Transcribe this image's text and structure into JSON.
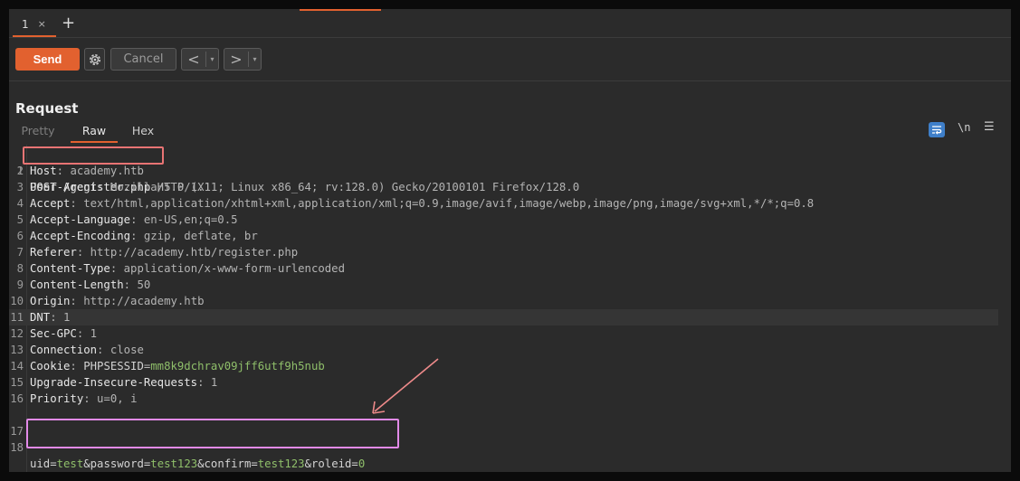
{
  "tabs": {
    "active": "1",
    "close": "×",
    "new": "+"
  },
  "toolbar": {
    "send": "Send",
    "cancel": "Cancel",
    "back": "<",
    "forward": ">",
    "dropdown": "▾"
  },
  "panel": {
    "title": "Request",
    "view_tabs": [
      "Pretty",
      "Raw",
      "Hex"
    ],
    "active_view": "Raw",
    "icons": {
      "wrap": "wrap-lines-icon",
      "newline": "\\n",
      "menu": "menu-icon"
    },
    "newline_label": "\\n",
    "menu_label": "☰"
  },
  "request": {
    "line1_a": "POST /register.php",
    "line1_b": " HTTP/1.1",
    "headers": [
      {
        "n": "2",
        "k": "Host",
        "v": "academy.htb"
      },
      {
        "n": "3",
        "k": "User-Agent",
        "v": "Mozilla/5.0 (X11; Linux x86_64; rv:128.0) Gecko/20100101 Firefox/128.0"
      },
      {
        "n": "4",
        "k": "Accept",
        "v": "text/html,application/xhtml+xml,application/xml;q=0.9,image/avif,image/webp,image/png,image/svg+xml,*/*;q=0.8"
      },
      {
        "n": "5",
        "k": "Accept-Language",
        "v": "en-US,en;q=0.5"
      },
      {
        "n": "6",
        "k": "Accept-Encoding",
        "v": "gzip, deflate, br"
      },
      {
        "n": "7",
        "k": "Referer",
        "v": "http://academy.htb/register.php"
      },
      {
        "n": "8",
        "k": "Content-Type",
        "v": "application/x-www-form-urlencoded"
      },
      {
        "n": "9",
        "k": "Content-Length",
        "v": "50"
      },
      {
        "n": "10",
        "k": "Origin",
        "v": "http://academy.htb"
      },
      {
        "n": "11",
        "k": "DNT",
        "v": "1"
      },
      {
        "n": "12",
        "k": "Sec-GPC",
        "v": "1"
      },
      {
        "n": "13",
        "k": "Connection",
        "v": "close"
      },
      {
        "n": "14",
        "k": "Cookie",
        "v": "PHPSESSID=mm8k9dchrav09jff6utf9h5nub"
      },
      {
        "n": "15",
        "k": "Upgrade-Insecure-Requests",
        "v": "1"
      },
      {
        "n": "16",
        "k": "Priority",
        "v": "u=0, i"
      }
    ],
    "cookie_name": "PHPSESSID",
    "cookie_value": "mm8k9dchrav09jff6utf9h5nub",
    "body_params": [
      {
        "name": "uid",
        "value": "test"
      },
      {
        "name": "password",
        "value": "test123"
      },
      {
        "name": "confirm",
        "value": "test123"
      },
      {
        "name": "roleid",
        "value": "0"
      }
    ]
  },
  "colors": {
    "accent": "#e2612f",
    "highlight_red": "#e87474",
    "highlight_pink": "#e28ae8",
    "param_value": "#8fbf6a"
  }
}
